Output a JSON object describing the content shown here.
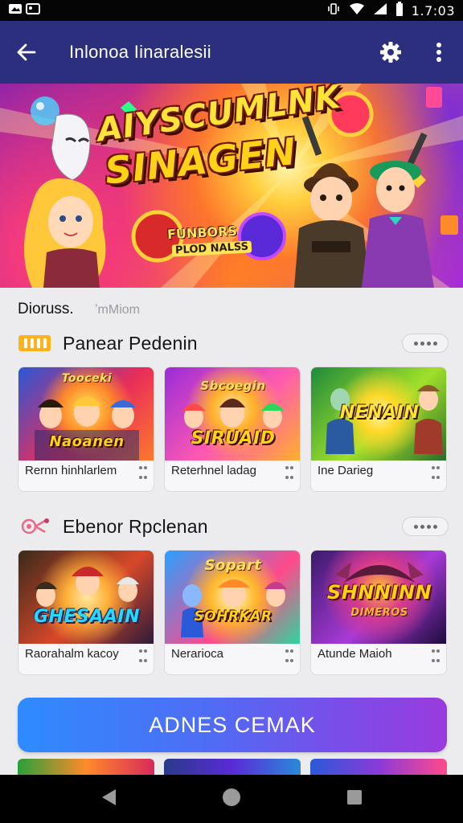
{
  "status_bar": {
    "time": "1.7:03",
    "left_icons": [
      "notification-icon",
      "image-icon"
    ],
    "right_icons": [
      "vibrate-icon",
      "wifi-icon",
      "signal-icon",
      "battery-icon"
    ]
  },
  "app_bar": {
    "title": "Inlonoa Iinaralesii",
    "back_icon": "arrow-left-icon",
    "settings_icon": "gear-icon",
    "menu_icon": "more-vert-icon"
  },
  "hero": {
    "title_line1": "AIYSCUMLNK",
    "title_line2": "SINAGEN",
    "sub_line1": "FUNBORS",
    "sub_line2": "PLOD NALSS"
  },
  "discover": {
    "label": "Dioruss.",
    "sub": "ʼmMiom"
  },
  "sections": [
    {
      "title": "Panear Pedenin",
      "icon": "tag-badge-icon",
      "more_icon": "more-horiz-icon",
      "cards": [
        {
          "label": "Rernn hinhlarlem",
          "thumb_title": "Naoanen",
          "thumb_top": "Tooceki",
          "colors": [
            "#2a57d6",
            "#ff7a2a",
            "#e82d5a"
          ]
        },
        {
          "label": "Reterhnel ladag",
          "thumb_title": "SIRUAID",
          "thumb_top": "Sbcoegin",
          "colors": [
            "#9b2bd8",
            "#ff5ab0",
            "#ffb02a"
          ]
        },
        {
          "label": "Ine Darieg",
          "thumb_title": "NENAIN",
          "thumb_top": "",
          "colors": [
            "#1f8a3a",
            "#9fe02a",
            "#ffd82a"
          ]
        }
      ]
    },
    {
      "title": "Ebenor Rpclenan",
      "icon": "candy-icon",
      "more_icon": "more-horiz-icon",
      "cards": [
        {
          "label": "Raorahalm kacoy",
          "thumb_title": "GHESAAIN",
          "thumb_top": "",
          "colors": [
            "#3a2a1a",
            "#d8482a",
            "#ffd23a"
          ]
        },
        {
          "label": "Nerarioca",
          "thumb_title": "SOHRKAR",
          "thumb_top": "Sopart",
          "colors": [
            "#2aa0ff",
            "#ffb82a",
            "#ff4a8a"
          ]
        },
        {
          "label": "Atunde Maioh",
          "thumb_title": "SHNNINN",
          "thumb_top": "DIMEROS",
          "colors": [
            "#3a1a6a",
            "#a83ad8",
            "#ff8a2a"
          ]
        }
      ]
    }
  ],
  "cta": {
    "label": "ADNES CEMAK"
  },
  "nav": {
    "back_icon": "nav-back-icon",
    "home_icon": "nav-home-icon",
    "recents_icon": "nav-recents-icon"
  }
}
